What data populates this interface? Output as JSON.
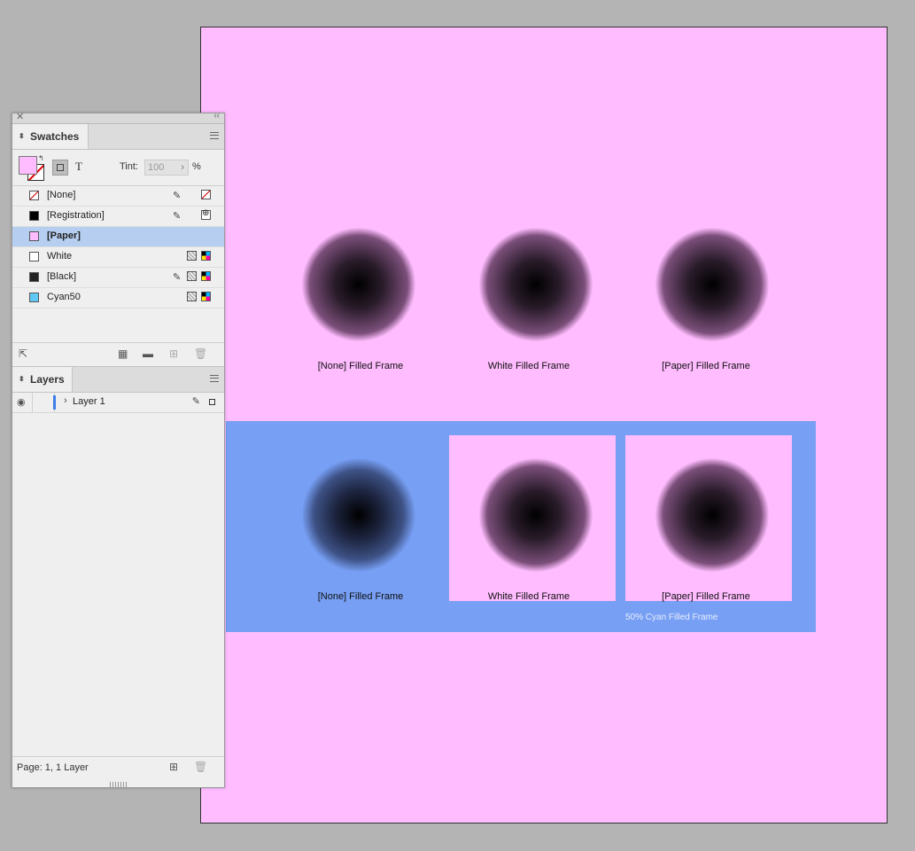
{
  "panel": {
    "close_glyph": "✕",
    "collapse_glyph": "‹‹",
    "swatches": {
      "tab_label": "Swatches",
      "tint_label": "Tint:",
      "tint_value": "100",
      "tint_unit": "%",
      "text_mode_glyph": "T",
      "items": [
        {
          "name": "[None]",
          "color": "none",
          "selected": false
        },
        {
          "name": "[Registration]",
          "color": "#000000",
          "selected": false
        },
        {
          "name": "[Paper]",
          "color": "#ffbcff",
          "selected": true
        },
        {
          "name": "White",
          "color": "#ffffff",
          "selected": false
        },
        {
          "name": "[Black]",
          "color": "#222222",
          "selected": false
        },
        {
          "name": "Cyan50",
          "color": "#60c8f5",
          "selected": false
        }
      ]
    },
    "layers": {
      "tab_label": "Layers",
      "layer_name": "Layer 1",
      "status": "Page: 1, 1 Layer"
    }
  },
  "document": {
    "paper_color": "#ffbcff",
    "cyan_frame_color": "#779ff4",
    "top_captions": [
      "[None] Filled Frame",
      "White Filled Frame",
      "[Paper] Filled Frame"
    ],
    "bottom_captions": [
      "[None] Filled Frame",
      "White Filled Frame",
      "[Paper] Filled Frame"
    ],
    "cyan_caption": "50% Cyan Filled Frame"
  }
}
